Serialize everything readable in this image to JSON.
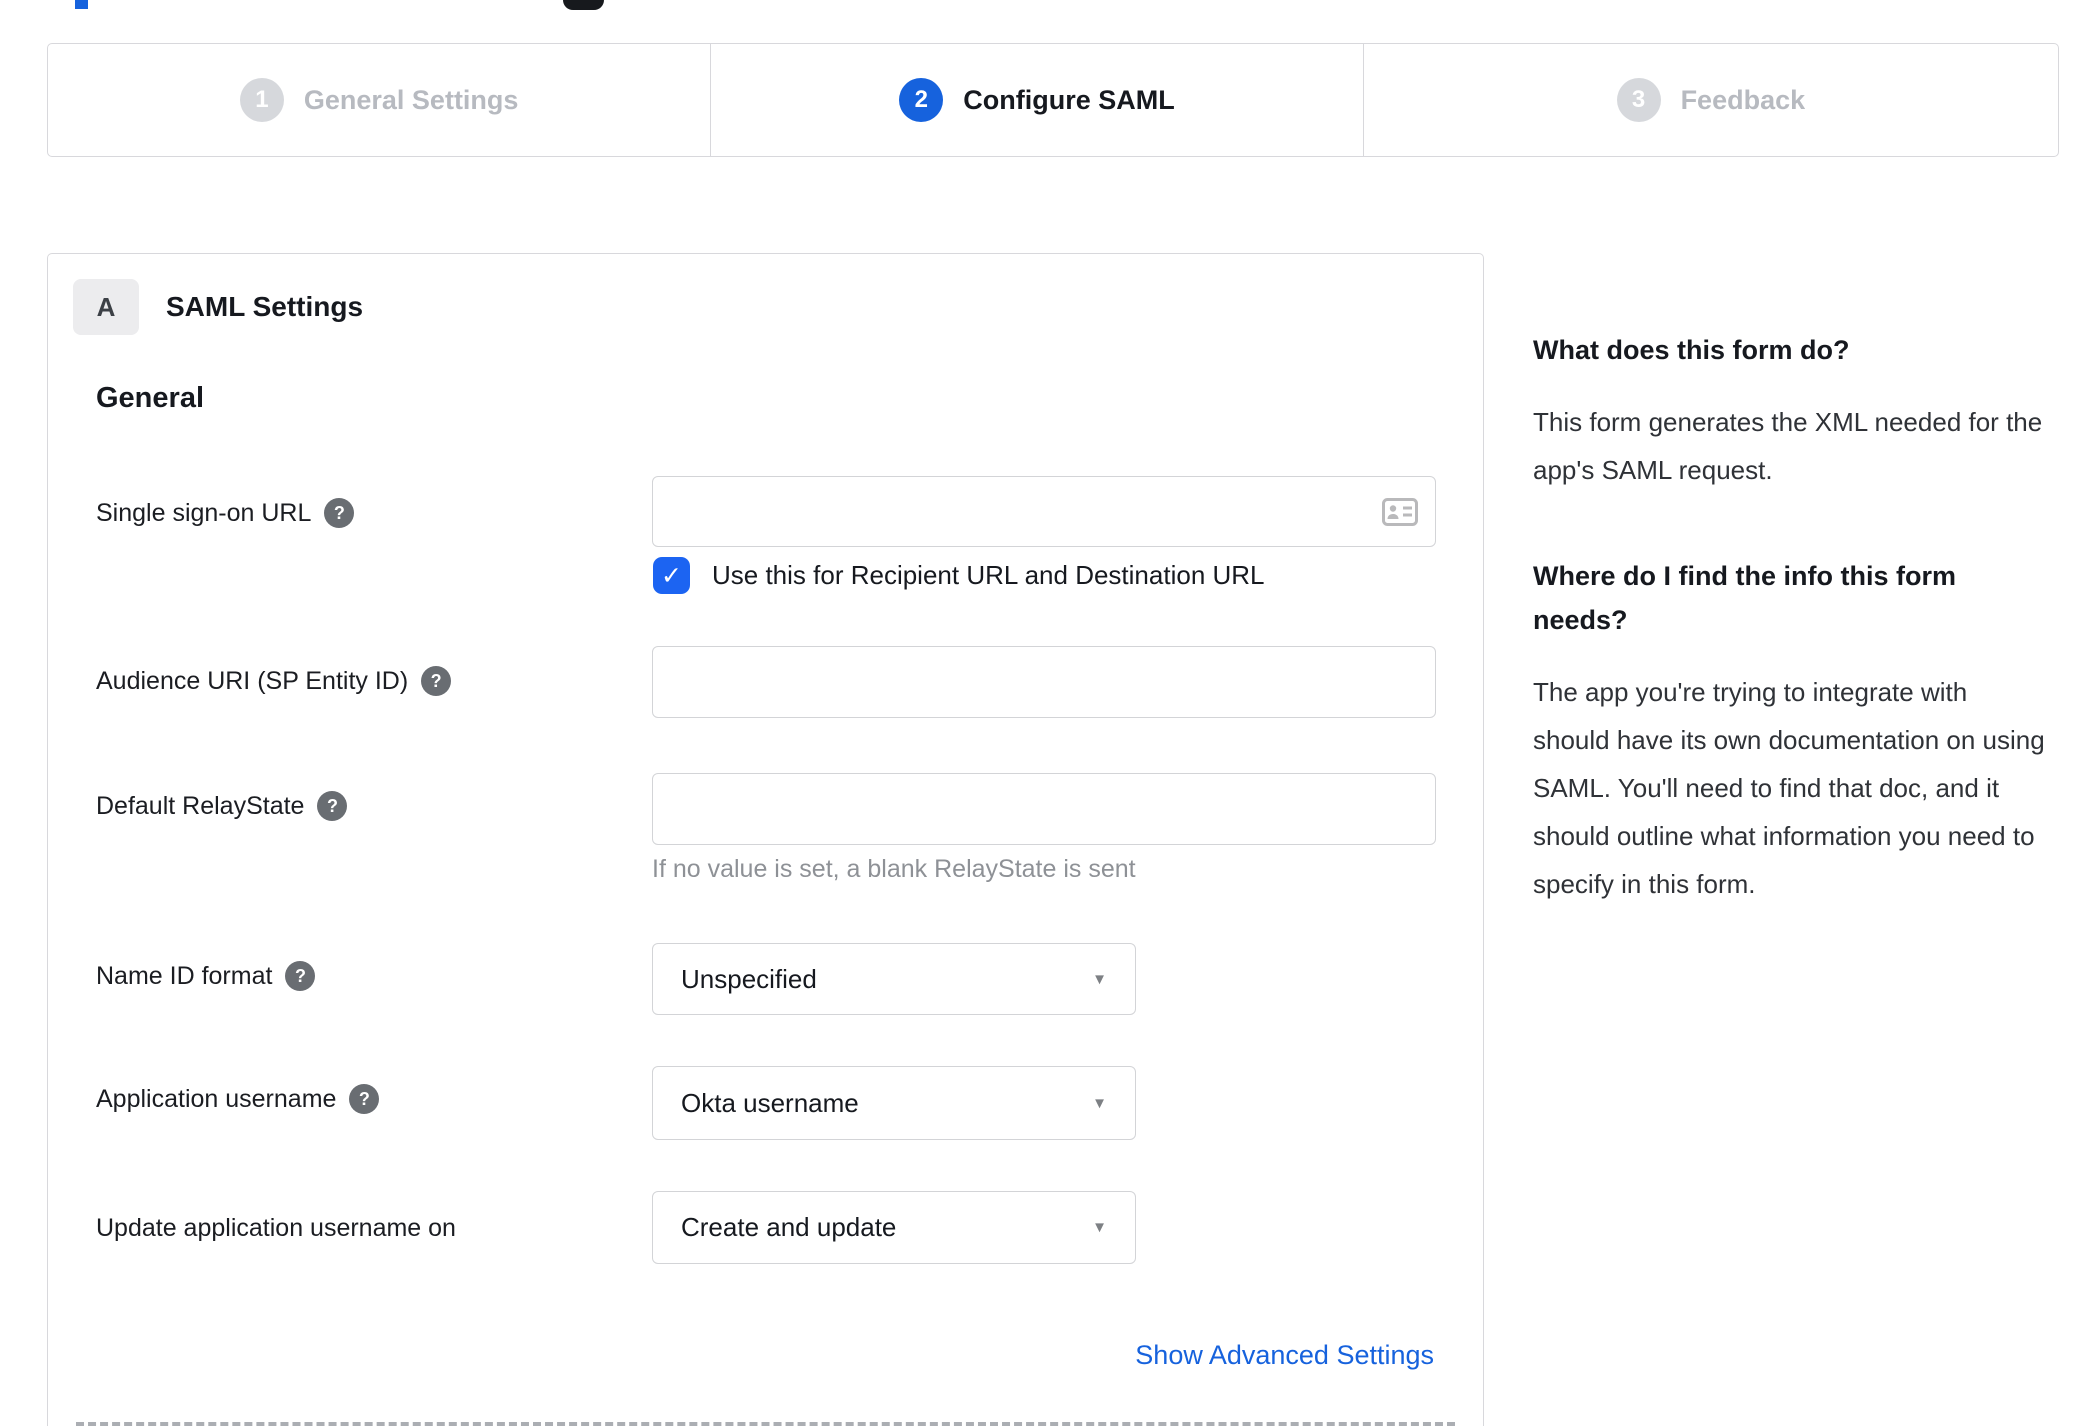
{
  "stepper": {
    "steps": [
      {
        "number": "1",
        "label": "General Settings",
        "state": "inactive"
      },
      {
        "number": "2",
        "label": "Configure SAML",
        "state": "active"
      },
      {
        "number": "3",
        "label": "Feedback",
        "state": "inactive"
      }
    ]
  },
  "panel": {
    "badge": "A",
    "title": "SAML Settings",
    "section": "General",
    "fields": [
      {
        "label": "Single sign-on URL",
        "value": "",
        "checkbox_checked": true,
        "checkbox_label": "Use this for Recipient URL and Destination URL"
      },
      {
        "label": "Audience URI (SP Entity ID)",
        "value": ""
      },
      {
        "label": "Default RelayState",
        "value": "",
        "helper": "If no value is set, a blank RelayState is sent"
      },
      {
        "label": "Name ID format",
        "value": "Unspecified"
      },
      {
        "label": "Application username",
        "value": "Okta username"
      },
      {
        "label": "Update application username on",
        "value": "Create and update"
      }
    ],
    "advanced_link": "Show Advanced Settings"
  },
  "sidebar": {
    "sections": [
      {
        "heading": "What does this form do?",
        "body": "This form generates the XML needed for the app's SAML request."
      },
      {
        "heading": "Where do I find the info this form needs?",
        "body": "The app you're trying to integrate with should have its own documentation on using SAML. You'll need to find that doc, and it should outline what information you need to specify in this form."
      }
    ]
  },
  "icons": {
    "help": "?",
    "dropdown": "▼",
    "check": "✓"
  },
  "colors": {
    "accent_blue": "#1662dd",
    "checkbox_blue": "#1c64f2",
    "border_grey": "#d8d8dc",
    "inactive_grey": "#b7bac0",
    "helper_grey": "#8e9196"
  }
}
